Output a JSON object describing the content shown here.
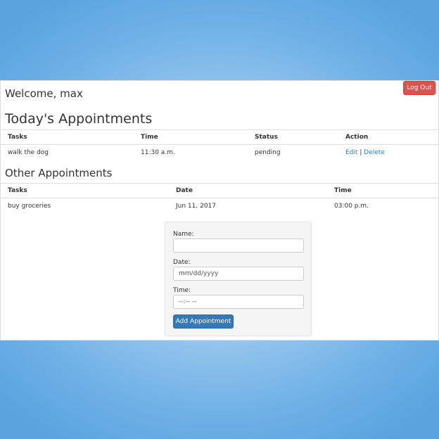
{
  "header": {
    "welcome": "Welcome, max",
    "logout_label": "Log Out"
  },
  "today": {
    "title": "Today's Appointments",
    "columns": [
      "Tasks",
      "Time",
      "Status",
      "Action"
    ],
    "rows": [
      {
        "task": "walk the dog",
        "time": "11:30 a.m.",
        "status": "pending",
        "edit_label": "Edit",
        "separator": "|",
        "delete_label": "Delete"
      }
    ]
  },
  "other": {
    "title": "Other Appointments",
    "columns": [
      "Tasks",
      "Date",
      "Time"
    ],
    "rows": [
      {
        "task": "buy groceries",
        "date": "Jun 11, 2017",
        "time": "03:00 p.m."
      }
    ]
  },
  "form": {
    "name_label": "Name:",
    "name_value": "",
    "date_label": "Date:",
    "date_placeholder": "mm/dd/yyyy",
    "time_label": "Time:",
    "time_placeholder": "--:-- --",
    "submit_label": "Add Appointment"
  },
  "colors": {
    "danger": "#d9534f",
    "primary": "#337ab7",
    "background_blue": "#6eb0e6"
  }
}
